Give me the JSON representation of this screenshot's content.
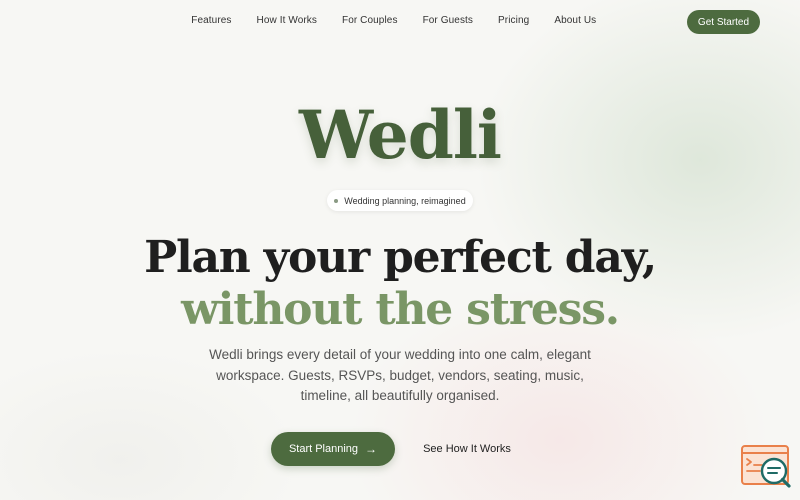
{
  "nav": {
    "links": [
      "Features",
      "How It Works",
      "For Couples",
      "For Guests",
      "Pricing",
      "About Us"
    ],
    "cta_label": "Get Started"
  },
  "hero": {
    "brand": "Wedli",
    "badge": "Wedding planning, reimagined",
    "headline_line1": "Plan your perfect day,",
    "headline_line2": "without the stress.",
    "subtext": "Wedli brings every detail of your wedding into one calm, elegant workspace. Guests, RSVPs, budget, vendors, seating, music, timeline, all beautifully organised.",
    "primary_label": "Start Planning",
    "primary_icon": "arrow-right-icon",
    "secondary_label": "See How It Works"
  },
  "widget": {
    "icon": "search-document-icon"
  },
  "colors": {
    "accent": "#4d6b3f",
    "brand": "#46603a",
    "headline_secondary": "#7a9666",
    "background": "#f7f7f4",
    "widget_orange": "#e9804a",
    "widget_teal": "#1f6b66"
  }
}
